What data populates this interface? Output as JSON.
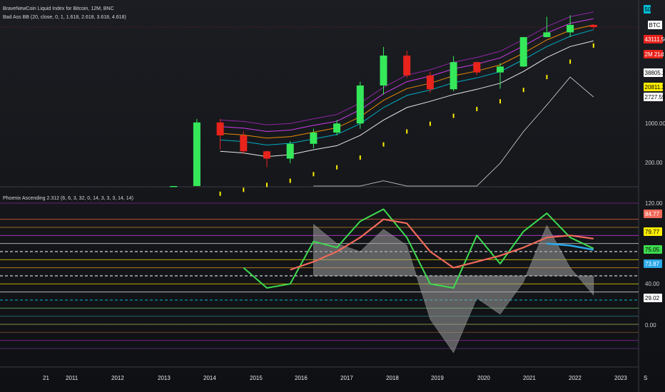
{
  "header": {
    "main_title": "BraveNewCoin Liquid Index for Bitcoin, 12M, BNC",
    "bb_legend": "Bad Ass BB (20, close, 0, 1, 1.618, 2.618, 3.618, 4.618)",
    "osc_legend": "Phoenix Ascending 2.312 (6, 6, 3, 32, 0, 14, 3, 3, 3, 14, 14)"
  },
  "colors": {
    "up": "#35e85a",
    "down": "#e8231c",
    "bb_mid": "#ffffff",
    "bb_1": "#00bcd4",
    "bb_2": "#ff9800",
    "bb_3": "#e040fb",
    "bb_4": "#9c27b0",
    "dots": "#ffee00",
    "osc_green": "#3ddc4f",
    "osc_red": "#f06a5a",
    "osc_blue": "#29a7e6",
    "osc_fill": "#9e9e9e",
    "panel_bg": "#131418",
    "grid": "#2a2c33"
  },
  "price_scale": {
    "tags": [
      {
        "text": "50",
        "bg": "#00bcd4",
        "fg": "#000000"
      },
      {
        "text": "BTC",
        "bg": "#ffffff",
        "fg": "#000000"
      },
      {
        "text": "43111.50",
        "bg": "#e8231c",
        "fg": "#ffffff"
      },
      {
        "text": "2M 21d",
        "bg": "#e8231c",
        "fg": "#ffffff"
      },
      {
        "text": "38805.20",
        "bg": "#ffffff",
        "fg": "#000000"
      },
      {
        "text": "20811.39",
        "bg": "#ffee00",
        "fg": "#000000"
      },
      {
        "text": "2727.59",
        "bg": "#ffffff",
        "fg": "#000000"
      }
    ],
    "labels": [
      "1000.00",
      "200.00"
    ]
  },
  "osc_scale": {
    "tags": [
      {
        "text": "84.77",
        "bg": "#f06a5a",
        "fg": "#ffffff"
      },
      {
        "text": "79.77",
        "bg": "#ffee00",
        "fg": "#000000"
      },
      {
        "text": "75.05",
        "bg": "#3ddc4f",
        "fg": "#000000"
      },
      {
        "text": "73.87",
        "bg": "#29a7e6",
        "fg": "#ffffff"
      },
      {
        "text": "29.02",
        "bg": "#ffffff",
        "fg": "#000000"
      }
    ],
    "labels": [
      "120.00",
      "40.00",
      "0.00"
    ]
  },
  "time_axis": {
    "labels": [
      "21",
      "2011",
      "2012",
      "2013",
      "2014",
      "2015",
      "2016",
      "2017",
      "2018",
      "2019",
      "2020",
      "2021",
      "2022",
      "2023",
      "S"
    ]
  },
  "chart_data": [
    {
      "type": "candlestick",
      "title": "BraveNewCoin Liquid Index for Bitcoin, 12M, BNC",
      "scale": "log",
      "x": [
        "2013",
        "2013.5",
        "2014",
        "2014.5",
        "2015",
        "2015.5",
        "2016",
        "2016.5",
        "2017",
        "2017.5",
        "2018",
        "2018.5",
        "2019",
        "2019.5",
        "2020",
        "2020.5",
        "2021",
        "2021.5",
        "2022"
      ],
      "candles": [
        {
          "o": 12,
          "c": 20,
          "h": 24,
          "l": 10
        },
        {
          "o": 20,
          "c": 1000,
          "h": 1150,
          "l": 18
        },
        {
          "o": 1000,
          "c": 600,
          "h": 1150,
          "l": 350
        },
        {
          "o": 600,
          "c": 320,
          "h": 700,
          "l": 290
        },
        {
          "o": 320,
          "c": 240,
          "h": 330,
          "l": 170
        },
        {
          "o": 240,
          "c": 430,
          "h": 480,
          "l": 200
        },
        {
          "o": 430,
          "c": 670,
          "h": 780,
          "l": 360
        },
        {
          "o": 670,
          "c": 960,
          "h": 1100,
          "l": 600
        },
        {
          "o": 960,
          "c": 4300,
          "h": 5000,
          "l": 780
        },
        {
          "o": 4300,
          "c": 14000,
          "h": 19700,
          "l": 3000
        },
        {
          "o": 14000,
          "c": 6400,
          "h": 17000,
          "l": 5800
        },
        {
          "o": 6400,
          "c": 3700,
          "h": 7400,
          "l": 3200
        },
        {
          "o": 3700,
          "c": 10800,
          "h": 13800,
          "l": 3400
        },
        {
          "o": 10800,
          "c": 7200,
          "h": 11000,
          "l": 6500
        },
        {
          "o": 7200,
          "c": 9100,
          "h": 10500,
          "l": 3800
        },
        {
          "o": 9100,
          "c": 29000,
          "h": 29300,
          "l": 8900
        },
        {
          "o": 29000,
          "c": 35000,
          "h": 64800,
          "l": 28800
        },
        {
          "o": 35000,
          "c": 47000,
          "h": 69000,
          "l": 29000
        },
        {
          "o": 47000,
          "c": 43111.5,
          "h": 48000,
          "l": 40000
        }
      ],
      "bands": [
        {
          "name": "basis",
          "values": [
            null,
            null,
            320,
            300,
            260,
            280,
            340,
            400,
            600,
            1100,
            1800,
            2300,
            3000,
            3700,
            4700,
            7500,
            13000,
            20000,
            25000
          ]
        },
        {
          "name": "band 1",
          "values": [
            null,
            null,
            500,
            470,
            410,
            440,
            520,
            620,
            950,
            1800,
            2900,
            3600,
            4800,
            5800,
            7400,
            12000,
            20000,
            30000,
            38805.2
          ]
        },
        {
          "name": "band 2",
          "values": [
            null,
            null,
            650,
            610,
            540,
            570,
            680,
            810,
            1250,
            2400,
            3800,
            4700,
            6300,
            7600,
            9700,
            15500,
            26000,
            38000,
            47000
          ]
        },
        {
          "name": "band 3",
          "values": [
            null,
            null,
            850,
            800,
            700,
            740,
            890,
            1050,
            1650,
            3100,
            5000,
            6200,
            8300,
            10000,
            12800,
            20500,
            34000,
            50000,
            60000
          ]
        },
        {
          "name": "band 4",
          "values": [
            null,
            null,
            1100,
            1040,
            910,
            960,
            1150,
            1370,
            2150,
            4000,
            6500,
            8000,
            10800,
            13000,
            16600,
            26500,
            44000,
            65000,
            78000
          ]
        }
      ],
      "dots": [
        null,
        null,
        60,
        70,
        85,
        100,
        130,
        170,
        250,
        420,
        700,
        950,
        1300,
        1700,
        2300,
        3600,
        6000,
        11000,
        20811.39
      ],
      "lower_line": [
        null,
        null,
        null,
        null,
        null,
        null,
        20,
        40,
        60,
        100,
        30,
        3,
        15,
        60,
        200,
        700,
        2000,
        6000,
        2727.59
      ]
    },
    {
      "type": "line",
      "title": "Phoenix Ascending 2.312 (6, 6, 3, 32, 0, 14, 3, 3, 3, 14, 14)",
      "ylim": [
        -20,
        120
      ],
      "x": [
        "2014.5",
        "2015",
        "2015.5",
        "2016",
        "2016.5",
        "2017",
        "2017.5",
        "2018",
        "2018.5",
        "2019",
        "2019.5",
        "2020",
        "2020.5",
        "2021",
        "2021.5",
        "2022"
      ],
      "series": [
        {
          "values": [
            56,
            36,
            40,
            82,
            76,
            102,
            114,
            86,
            40,
            36,
            88,
            60,
            92,
            110,
            86,
            75.05
          ]
        },
        {
          "values": [
            null,
            null,
            54,
            62,
            72,
            86,
            104,
            100,
            72,
            56,
            62,
            68,
            76,
            86,
            88,
            84.77
          ]
        },
        {
          "values": [
            null,
            null,
            null,
            null,
            null,
            null,
            null,
            null,
            null,
            null,
            null,
            null,
            null,
            80,
            78,
            73.87
          ]
        },
        {
          "values": [
            null,
            null,
            null,
            99,
            80,
            72,
            94,
            78,
            5,
            -28,
            26,
            10,
            42,
            98,
            56,
            29.02
          ]
        }
      ],
      "levels": [
        120,
        104,
        96,
        88,
        80,
        72,
        64,
        56,
        48,
        40,
        32,
        24,
        16,
        8,
        0,
        -8,
        -16,
        -24
      ]
    }
  ]
}
